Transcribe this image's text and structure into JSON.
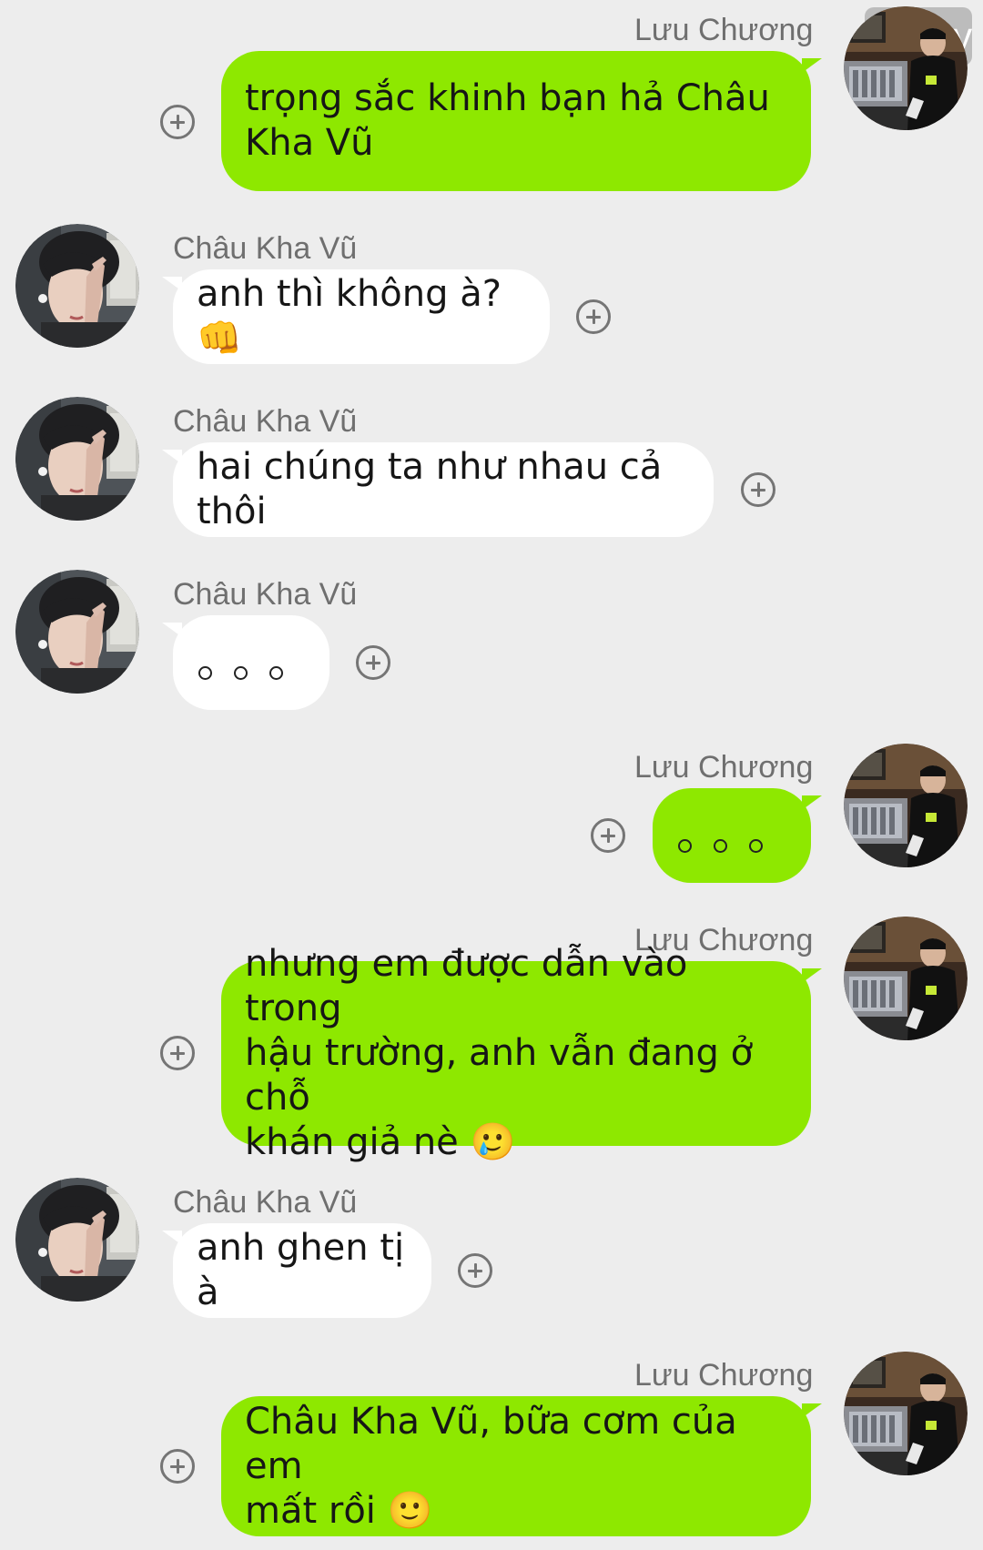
{
  "watermark": "44 joy",
  "messages": [
    {
      "sender": "Lưu Chương",
      "text": "trọng sắc khinh bạn hả Châu\nKha Vũ"
    },
    {
      "sender": "Châu Kha Vũ",
      "text": "anh thì không à? 👊"
    },
    {
      "sender": "Châu Kha Vũ",
      "text": "hai chúng ta như nhau cả thôi"
    },
    {
      "sender": "Châu Kha Vũ",
      "text": "。。。"
    },
    {
      "sender": "Lưu Chương",
      "text": "。。。"
    },
    {
      "sender": "Lưu Chương",
      "text": "nhưng em được dẫn vào trong\nhậu trường, anh vẫn đang ở chỗ\nkhán giả nè 🥲"
    },
    {
      "sender": "Châu Kha Vũ",
      "text": "anh ghen tị à"
    },
    {
      "sender": "Lưu Chương",
      "text": "Châu Kha Vũ, bữa cơm của em\nmất rồi 🙂"
    }
  ],
  "colors": {
    "background": "#ededed",
    "outgoing_bubble": "#8ee800",
    "incoming_bubble": "#ffffff",
    "name_text": "#6f6f6f"
  },
  "icons": {
    "add_reaction": "plus-circle-icon"
  }
}
